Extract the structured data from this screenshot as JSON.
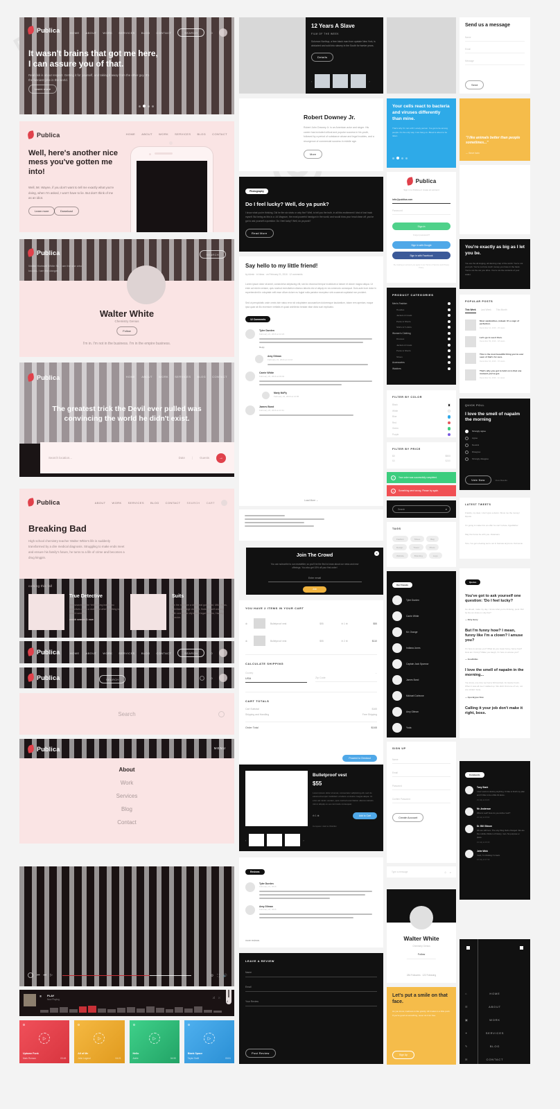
{
  "brand": {
    "name": "Publica",
    "accent": "#e0414b"
  },
  "hero1": {
    "nav": [
      "HOME",
      "ABOUT",
      "WORK",
      "SERVICES",
      "BLOG",
      "CONTACT"
    ],
    "search_label": "SEARCH",
    "cart_label": "0",
    "title": "It wasn't brains that got me here,\nI can assure you of that.",
    "subtitle": "Real risk is about respect. Getting it for yourself, and taking it away from the other guy. It's the funniest joke in the world.",
    "cta": "Learn more"
  },
  "hero2": {
    "nav": [
      "HOME",
      "ABOUT",
      "WORK",
      "SERVICES",
      "BLOG",
      "CONTACT"
    ],
    "title": "Well, here's another nice mess you've gotten me into!",
    "body": "Well, Mr. Wayne, if you don't want to tell me exactly what you're doing, when I'm asked, I won't have to lie. But don't think of me as an idiot.",
    "cta1": "Learn more",
    "cta2": "Download"
  },
  "profile_hero": {
    "search_label": "SEARCH",
    "tagline": "Walter Hartwell White Sr., I am the one who knocks. I am the danger.",
    "name": "Walter White",
    "role": "Chemistry Genius",
    "follow": "Follow",
    "quote": "I'm in. I'm not in the business. I'm in the empire business."
  },
  "booking": {
    "nav": [
      "HOME",
      "ABOUT",
      "WORK",
      "SERVICES",
      "BLOG",
      "CONTACT"
    ],
    "title": "The greatest trick the Devil ever pulled was convincing the world he didn't exist.",
    "field_location": "Search location...",
    "field_date": "Date",
    "field_guests": "Guests",
    "submit": "→"
  },
  "show": {
    "nav": [
      "ABOUT",
      "WORK",
      "SERVICES",
      "BLOG",
      "CONTACT"
    ],
    "search_label": "Search",
    "cart_label": "Cart",
    "title": "Breaking Bad",
    "body": "High school chemistry teacher Walter White's life is suddenly transformed by a dire medical diagnosis. Struggling to make ends meet and ensure his family's future, he turns to a life of crime and becomes a drug kingpin.",
    "section_label": "coming this fall",
    "cards": [
      {
        "title": "True Detective",
        "body": "The search for the Yellow King leads two detectives down a dark road where nothing is what it seems.",
        "link": "watch season 1 now"
      },
      {
        "title": "Suits",
        "body": "On the run from a drug deal gone bad, Mike Ross, a brilliant college dropout, finds himself working with one of the city's best legal closers, Harvey Specter."
      }
    ]
  },
  "navbars": {
    "bar_a_nav": [
      "HOME",
      "ABOUT",
      "WORK",
      "SERVICES",
      "BLOG",
      "CONTACT"
    ],
    "bar_a_search": "SEARCH",
    "bar_a_cart": "0",
    "bar_b_search": "SEARCH",
    "bar_b_cart": "0",
    "search_placeholder": "Search",
    "menu_label": "MENU",
    "menu_items": [
      "About",
      "Work",
      "Services",
      "Blog",
      "Contact"
    ]
  },
  "player": {
    "time": "",
    "now_playing_title": "PLAY",
    "now_playing_sub": "Now Playing",
    "volume": "4"
  },
  "music_cards": [
    {
      "color": "#e8434b",
      "title": "Uptown Funk",
      "sub": "Mark Ronson",
      "meta": "03:45"
    },
    {
      "color": "#f0ab2e",
      "title": "All of Me",
      "sub": "John Legend",
      "meta": "04:21"
    },
    {
      "color": "#2fb673",
      "title": "Hello",
      "sub": "Adele",
      "meta": "04:55"
    },
    {
      "color": "#3a9fe0",
      "title": "Blank Space",
      "sub": "Taylor Swift",
      "meta": "03:51"
    }
  ],
  "movie_feature": {
    "title": "12 Years A Slave",
    "kicker": "FILM OF THE WEEK",
    "body": "Solomon Northup, a free black man from upstate New York, is abducted and sold into slavery in the South for twelve years.",
    "cta": "Details"
  },
  "actor": {
    "title": "Robert Downey Jr.",
    "body": "Robert John Downey Jr. is an American actor and singer. His career has included critical and popular success in his youth, followed by a period of substance abuse and legal troubles, and a resurgence of commercial success in middle age.",
    "cta": "More"
  },
  "post_dark": {
    "tag": "Photography",
    "title": "Do I feel lucky? Well, do ya punk?",
    "body": "I know what you're thinking. Did he fire six shots or only five? Well, to tell you the truth, in all this excitement I kind of lost track myself. But being as this is a .44 Magnum, the most powerful handgun in the world, and would blow your head clean off, you've got to ask yourself a question: Do I feel lucky? Well, do ya punk?",
    "cta": "Read More"
  },
  "post_light": {
    "title": "Say hello to my little friend!",
    "meta": "by Admin · in News · on February 21, 2016 · 12 comments",
    "comments_label": "12 Comments",
    "comments": [
      {
        "name": "Tyler Durden",
        "meta": "February 21, 2016 at 12:24",
        "reply": "Reply"
      },
      {
        "name": "Amy Gilman",
        "meta": "February 21, 2016 at 13:10",
        "reply": "Reply"
      },
      {
        "name": "Carrie White",
        "meta": "February 22, 2016 at 09:42",
        "reply": "Reply"
      },
      {
        "name": "Marty McFly",
        "meta": "February 22, 2016 at 14:05",
        "reply": "Reply"
      },
      {
        "name": "James Bond",
        "meta": "February 23, 2016 at 11:31",
        "reply": "Reply"
      }
    ],
    "load_more": "Load More"
  },
  "newsletter": {
    "title": "Join The Crowd",
    "body": "You can subscribe to our newsletter, so you'll be the first to know about our news and new offerings. You also get 15% off your first order!",
    "placeholder": "Enter email",
    "cta": "Join"
  },
  "cart": {
    "title": "YOU HAVE 2 ITEMS IN YOUR CART",
    "rows": [
      {
        "name": "Bulletproof vest",
        "price": "$55",
        "qty": "1",
        "total": "$55"
      },
      {
        "name": "Bulletproof vest",
        "price": "$55",
        "qty": "2",
        "total": "$110"
      }
    ],
    "shipping_title": "CALCULATE SHIPPING",
    "country_label": "Country",
    "state_label": "State",
    "country_value": "USA",
    "state_placeholder": "Zip Code",
    "totals_title": "CART TOTALS",
    "subtotal_label": "Cart Subtotal",
    "subtotal_value": "$165",
    "shipping_label": "Shipping and Handling",
    "shipping_value": "Free Shipping",
    "grand_label": "Order Total",
    "grand_value": "$165",
    "cta": "Proceed to Checkout"
  },
  "product": {
    "title": "Bulletproof vest",
    "price": "$55",
    "body": "Lorem ipsum dolor sit amet, consectetur adipiscing elit, sed do eiusmod tempor incididunt ut labore et dolore magna aliqua. Ut enim ad minim veniam, quis nostrud exercitation ullamco laboris nisi ut aliquip ex ea commodo consequat.",
    "qty": "1",
    "cta": "Add to Cart",
    "note": "Compare / Add to Wishlist"
  },
  "reviews": {
    "tag": "Reviews",
    "items": [
      {
        "name": "Tyler Durden",
        "meta": "February 21, 2016"
      },
      {
        "name": "Amy Gilman",
        "meta": "February 22, 2016"
      }
    ],
    "form_title": "LEAVE A REVIEW",
    "fields": [
      "Name",
      "Email",
      "Your Review"
    ],
    "cta": "Post Review"
  },
  "mobile_hero": {
    "title": "Your cells react to bacteria and viruses differently than mine.",
    "body": "That's why I'm not a Mr. Lonely person. I've got to be among people. It's the only way I can hang on. Blood is about to be taken."
  },
  "signin": {
    "title": "Publica",
    "subtitle": "Sign in to Publica or create an account",
    "email_value": "info@publica.com",
    "password_placeholder": "Password",
    "cta": "Sign in",
    "forgot": "Forgot password?",
    "google": "Sign in with Google",
    "facebook": "Sign in with Facebook",
    "legal": "By creating an account you agree to our Terms of Service and Privacy Policy."
  },
  "categories": {
    "title": "PRODUCT CATEGORIES",
    "items": [
      "Men's Fashion",
      "Hoodies",
      "Jackets & Coats",
      "Pants & Shorts",
      "Shirts & T-shirts",
      "Women's Clothing",
      "Dresses",
      "Jackets & Coats",
      "Pants & Shorts",
      "Shoes",
      "Accessories",
      "Watches"
    ]
  },
  "filter_color": {
    "title": "FILTER BY COLOR",
    "items": [
      {
        "label": "Black",
        "color": "#151515"
      },
      {
        "label": "White",
        "color": "#ffffff"
      },
      {
        "label": "Blue",
        "color": "#2fa8e8"
      },
      {
        "label": "Red",
        "color": "#e4565c"
      },
      {
        "label": "Green",
        "color": "#3ccd7e"
      },
      {
        "label": "Purple",
        "color": "#7a5ae0"
      }
    ]
  },
  "filter_price": {
    "title": "FILTER BY PRICE",
    "min_label": "$0",
    "max_label": "$500",
    "min_value": "$0",
    "max_value": "$250"
  },
  "alerts": [
    {
      "type": "success",
      "text": "Your order was successfully completed.",
      "color": "#3ccd7e"
    },
    {
      "type": "error",
      "text": "Something went wrong. Please try again.",
      "color": "#f05054"
    }
  ],
  "search_dark": {
    "placeholder": "Search"
  },
  "tags": {
    "title": "TAGS",
    "items": [
      "Fashion",
      "Shoes",
      "Bag",
      "Design",
      "Travel",
      "Photo",
      "Website",
      "Branding",
      "Logo"
    ]
  },
  "members": {
    "tag": "Our Friends",
    "items": [
      "Tyler Durden",
      "Carrie White",
      "Mr. Orange",
      "Indiana Jones",
      "Captain Jack Sparrow",
      "James Bond",
      "Michael Corleone",
      "Amy Gilman",
      "Yoda"
    ]
  },
  "signup": {
    "title": "SIGN UP",
    "fields": [
      "Name",
      "Email",
      "Password",
      "Confirm Password"
    ],
    "cta": "Create Account"
  },
  "chat": {
    "placeholder": "Type a message"
  },
  "profile_card": {
    "name": "Walter White",
    "role": "Chemistry Genius",
    "cta": "Follow",
    "followers": "284 Followers",
    "following": "122 Following"
  },
  "yellow_card": {
    "title": "Let's put a smile on that face.",
    "body": "As you know, madness is like gravity. All it takes is a little push. If you're good at something, never do it for free.",
    "cta": "Sign Up"
  },
  "contact_form": {
    "title": "Send us a message",
    "fields": [
      "Name",
      "Email",
      "Message"
    ],
    "cta": "Send"
  },
  "quote_yellow": {
    "text": "\"I like animals better than people sometimes...\"",
    "author": "— Steve Irwin"
  },
  "quote_dark": {
    "title": "You're exactly as big as I let you be.",
    "body": "You are the all singing, all dancing crap of the world. You're not your job. You're not how much money you have in the bank. You're not the car you drive. You're not the contents of your wallet."
  },
  "popular_posts": {
    "title": "POPULAR POSTS",
    "tabs": [
      "This Week",
      "Last Week",
      "This Month"
    ],
    "items": [
      {
        "title": "Most sandwiches, indeed. It's a sign of perfection.",
        "meta": "December 12, 2016 · 23 views"
      },
      {
        "title": "Let's go to see it then.",
        "meta": "December 09, 2016 · 18 views"
      },
      {
        "title": "This is the most beautiful thing you've ever seen of that's for sure.",
        "meta": "December 04, 2016 · 15 views"
      },
      {
        "title": "That's why you got to hold on to that one moment you've got.",
        "meta": "December 01, 2016 · 11 views"
      }
    ]
  },
  "poll": {
    "title": "QUICK POLL",
    "question": "I love the smell of napalm the morning",
    "options": [
      "Strongly agree",
      "Agree",
      "Neutral",
      "Disagree",
      "Strongly disagree"
    ],
    "selected": 0,
    "cta": "Vote Now",
    "results": "View Results"
  },
  "tweets": {
    "title": "LATEST TWEETS",
    "items": [
      {
        "text": "Frankly, my dear, I don't give a damn. Show me the money! #quote",
        "meta": "2 hours ago"
      },
      {
        "text": "I'm going to make him an offer he can't refuse. #godfather",
        "meta": "5 hours ago"
      },
      {
        "text": "May the Force be with you. #starwars",
        "meta": "1 day ago"
      },
      {
        "text": "Toto, I've got a feeling we're not in Kansas anymore. #ozmovie",
        "meta": "2 days ago"
      }
    ]
  },
  "quotes_list": {
    "tag": "Quotes",
    "items": [
      {
        "title": "You've got to ask yourself one question: 'Do I feel lucky?",
        "body": "Go ahead, make my day. I know what you're thinking, punk. Did he fire six shots or only five?",
        "author": "— Dirty Harry"
      },
      {
        "title": "But I'm funny how? I mean, funny like I'm a clown? I amuse you?",
        "body": "I'm here to amuse you? What do you mean funny, funny how? How am I funny? Make you laugh, I'm here to amuse you?",
        "author": "— Goodfellas"
      },
      {
        "title": "I love the smell of napalm in the morning...",
        "body": "You know, one time we had a hill bombed, for twelve hours. When it was all over I walked up. We didn't find one of 'em, not one stinkin' body.",
        "author": "— Apocalypse Now"
      },
      {
        "title": "Calling it your job don't make it right, boss."
      }
    ]
  },
  "comments_dark": {
    "tag": "Comments",
    "items": [
      {
        "name": "Tony Stark",
        "body": "I don't want to destroy anything. I'd like to finish my plan and I'd like to be a little bit alone.",
        "meta": "21 July at 14:21"
      },
      {
        "name": "Mr. Anderson",
        "body": "What is real? How do you define 'real'?",
        "meta": "21 July at 15:02"
      },
      {
        "name": "Dr. Bill Gibson",
        "body": "We are still here. The only thing that's changed. We are the middle children of history, man. No purpose or place.",
        "meta": "21 July at 16:40"
      },
      {
        "name": "John Wick",
        "body": "Yeah, I'm thinking I'm back.",
        "meta": "21 July at 17:13"
      }
    ]
  },
  "menu_panel": {
    "items": [
      "HOME",
      "ABOUT",
      "WORK",
      "SERVICES",
      "BLOG",
      "CONTACT"
    ]
  }
}
